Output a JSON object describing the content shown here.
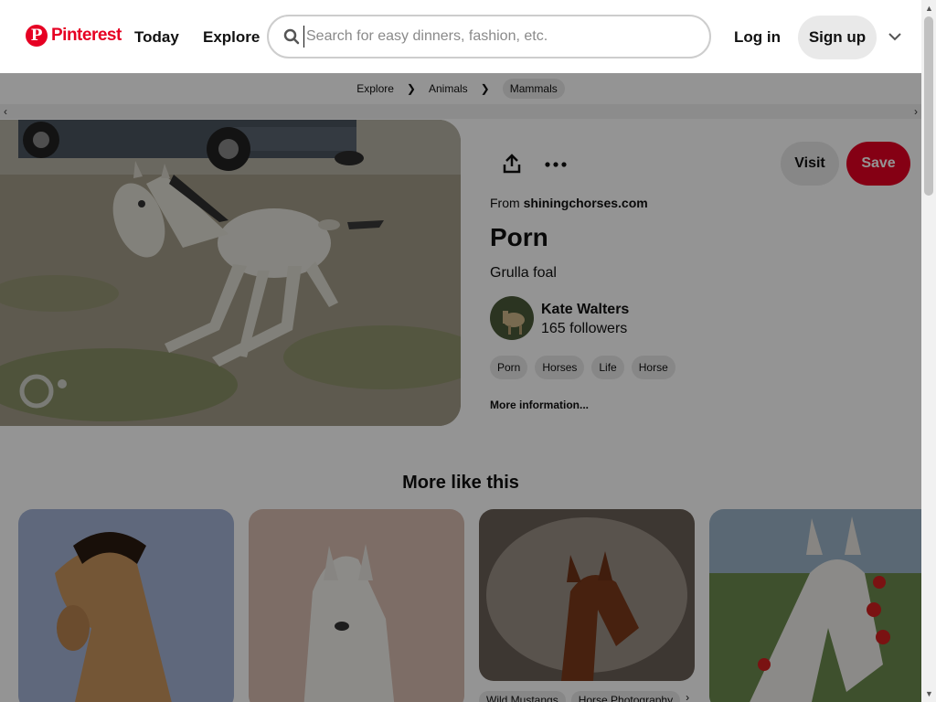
{
  "header": {
    "logo_text": "Pinterest",
    "nav": [
      {
        "label": "Today"
      },
      {
        "label": "Explore"
      }
    ],
    "search_placeholder": "Search for easy dinners, fashion, etc.",
    "login_label": "Log in",
    "signup_label": "Sign up"
  },
  "breadcrumb": [
    {
      "label": "Explore"
    },
    {
      "label": "Animals"
    },
    {
      "label": "Mammals"
    }
  ],
  "pin": {
    "visit_label": "Visit",
    "save_label": "Save",
    "from_prefix": "From",
    "source": "shiningchorses.com",
    "title": "Porn",
    "description": "Grulla foal",
    "creator": {
      "name": "Kate Walters",
      "followers": "165 followers"
    },
    "tags": [
      "Porn",
      "Horses",
      "Life",
      "Horse"
    ],
    "more_info_label": "More information..."
  },
  "more_like_title": "More like this",
  "related_cards": [
    {
      "icon": "buckskin-horse"
    },
    {
      "icon": "white-horse"
    },
    {
      "icon": "bay-foal"
    },
    {
      "icon": "arabian-horse"
    }
  ],
  "related_card_tags": [
    "Wild Mustangs",
    "Horse Photography"
  ],
  "colors": {
    "brand": "#e60023",
    "pill": "#e9e9e9"
  }
}
